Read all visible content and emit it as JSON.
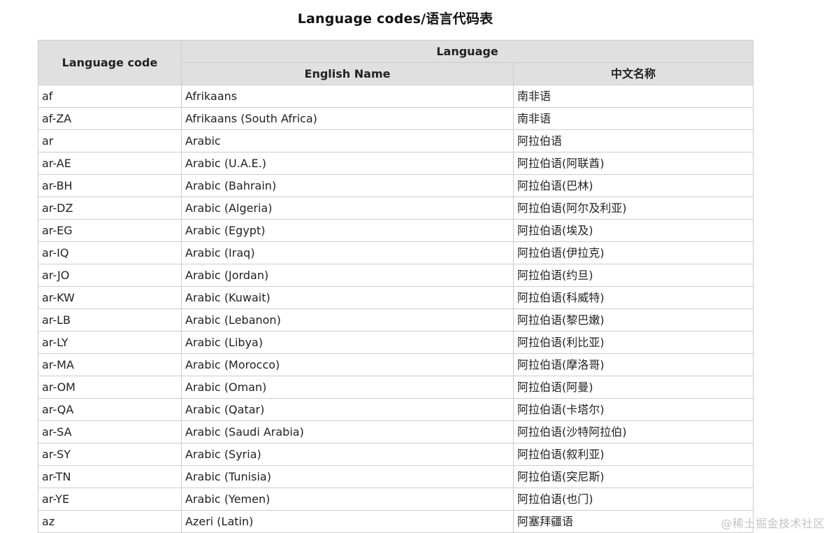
{
  "title": "Language codes/语言代码表",
  "table": {
    "header": {
      "code": "Language code",
      "language_group": "Language",
      "english": "English Name",
      "chinese": "中文名称"
    },
    "rows": [
      {
        "code": "af",
        "english": "Afrikaans",
        "chinese": "南非语"
      },
      {
        "code": "af-ZA",
        "english": "Afrikaans (South Africa)",
        "chinese": "南非语"
      },
      {
        "code": "ar",
        "english": "Arabic",
        "chinese": "阿拉伯语"
      },
      {
        "code": "ar-AE",
        "english": "Arabic (U.A.E.)",
        "chinese": "阿拉伯语(阿联酋)"
      },
      {
        "code": "ar-BH",
        "english": "Arabic (Bahrain)",
        "chinese": "阿拉伯语(巴林)"
      },
      {
        "code": "ar-DZ",
        "english": "Arabic (Algeria)",
        "chinese": "阿拉伯语(阿尔及利亚)"
      },
      {
        "code": "ar-EG",
        "english": "Arabic (Egypt)",
        "chinese": "阿拉伯语(埃及)"
      },
      {
        "code": "ar-IQ",
        "english": "Arabic (Iraq)",
        "chinese": "阿拉伯语(伊拉克)"
      },
      {
        "code": "ar-JO",
        "english": "Arabic (Jordan)",
        "chinese": "阿拉伯语(约旦)"
      },
      {
        "code": "ar-KW",
        "english": "Arabic (Kuwait)",
        "chinese": "阿拉伯语(科威特)"
      },
      {
        "code": "ar-LB",
        "english": "Arabic (Lebanon)",
        "chinese": "阿拉伯语(黎巴嫩)"
      },
      {
        "code": "ar-LY",
        "english": "Arabic (Libya)",
        "chinese": "阿拉伯语(利比亚)"
      },
      {
        "code": "ar-MA",
        "english": "Arabic (Morocco)",
        "chinese": "阿拉伯语(摩洛哥)"
      },
      {
        "code": "ar-OM",
        "english": "Arabic (Oman)",
        "chinese": "阿拉伯语(阿曼)"
      },
      {
        "code": "ar-QA",
        "english": "Arabic (Qatar)",
        "chinese": "阿拉伯语(卡塔尔)"
      },
      {
        "code": "ar-SA",
        "english": "Arabic (Saudi Arabia)",
        "chinese": "阿拉伯语(沙特阿拉伯)"
      },
      {
        "code": "ar-SY",
        "english": "Arabic (Syria)",
        "chinese": "阿拉伯语(叙利亚)"
      },
      {
        "code": "ar-TN",
        "english": "Arabic (Tunisia)",
        "chinese": "阿拉伯语(突尼斯)"
      },
      {
        "code": "ar-YE",
        "english": "Arabic (Yemen)",
        "chinese": "阿拉伯语(也门)"
      },
      {
        "code": "az",
        "english": "Azeri (Latin)",
        "chinese": "阿塞拜疆语"
      }
    ]
  },
  "watermark": "@稀土掘金技术社区",
  "colors": {
    "header_bg": "#e0e0e0",
    "border": "#cccccc",
    "text": "#222222",
    "watermark": "#c4c4c4"
  }
}
